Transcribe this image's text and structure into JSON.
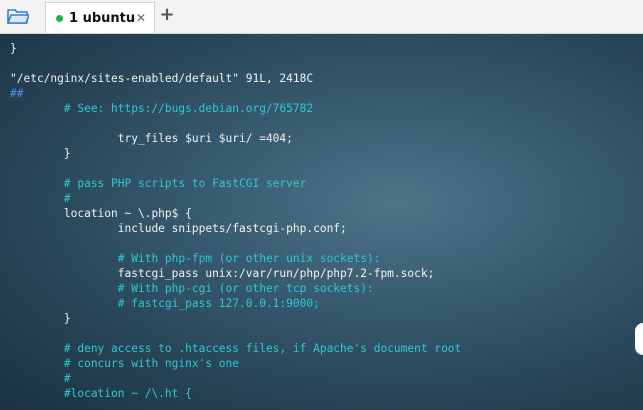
{
  "tabbar": {
    "tab": {
      "label": "1 ubuntu",
      "status_color": "#22b14c",
      "close_glyph": "✕"
    },
    "add_glyph": "+"
  },
  "terminal": {
    "lines": [
      {
        "text": "}",
        "kind": "code"
      },
      {
        "text": "",
        "kind": "code"
      },
      {
        "text": "\"/etc/nginx/sites-enabled/default\" 91L, 2418C",
        "kind": "code"
      },
      {
        "text": "##",
        "kind": "hash"
      },
      {
        "text": "        # See: https://bugs.debian.org/765782",
        "kind": "comment"
      },
      {
        "text": "",
        "kind": "code"
      },
      {
        "text": "                try_files $uri $uri/ =404;",
        "kind": "code"
      },
      {
        "text": "        }",
        "kind": "code"
      },
      {
        "text": "",
        "kind": "code"
      },
      {
        "text": "        # pass PHP scripts to FastCGI server",
        "kind": "comment"
      },
      {
        "text": "        #",
        "kind": "comment"
      },
      {
        "text": "        location ~ \\.php$ {",
        "kind": "code"
      },
      {
        "text": "                include snippets/fastcgi-php.conf;",
        "kind": "code"
      },
      {
        "text": "",
        "kind": "code"
      },
      {
        "text": "                # With php-fpm (or other unix sockets):",
        "kind": "comment"
      },
      {
        "text": "                fastcgi_pass unix:/var/run/php/php7.2-fpm.sock;",
        "kind": "code"
      },
      {
        "text": "                # With php-cgi (or other tcp sockets):",
        "kind": "comment"
      },
      {
        "text": "                # fastcgi_pass 127.0.0.1:9000;",
        "kind": "comment"
      },
      {
        "text": "        }",
        "kind": "code"
      },
      {
        "text": "",
        "kind": "code"
      },
      {
        "text": "        # deny access to .htaccess files, if Apache's document root",
        "kind": "comment"
      },
      {
        "text": "        # concurs with nginx's one",
        "kind": "comment"
      },
      {
        "text": "        #",
        "kind": "comment"
      },
      {
        "text": "        #location ~ /\\.ht {",
        "kind": "comment"
      }
    ]
  }
}
